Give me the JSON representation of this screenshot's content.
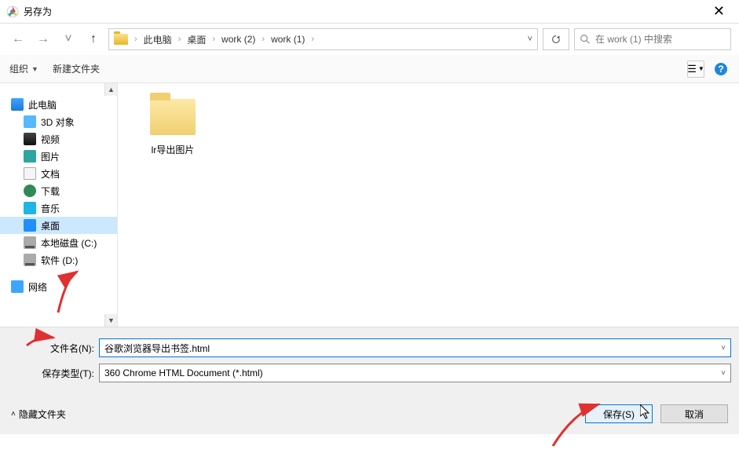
{
  "window": {
    "title": "另存为"
  },
  "breadcrumb": [
    "此电脑",
    "桌面",
    "work (2)",
    "work (1)"
  ],
  "search": {
    "placeholder": "在 work (1) 中搜索"
  },
  "toolbar": {
    "organize": "组织",
    "new_folder": "新建文件夹"
  },
  "tree": [
    {
      "label": "此电脑",
      "icon": "pc",
      "indent": false,
      "selected": false
    },
    {
      "label": "3D 对象",
      "icon": "3d",
      "indent": true,
      "selected": false
    },
    {
      "label": "视频",
      "icon": "vid",
      "indent": true,
      "selected": false
    },
    {
      "label": "图片",
      "icon": "pic",
      "indent": true,
      "selected": false
    },
    {
      "label": "文档",
      "icon": "doc",
      "indent": true,
      "selected": false
    },
    {
      "label": "下载",
      "icon": "dl",
      "indent": true,
      "selected": false
    },
    {
      "label": "音乐",
      "icon": "mus",
      "indent": true,
      "selected": false
    },
    {
      "label": "桌面",
      "icon": "desk",
      "indent": true,
      "selected": true
    },
    {
      "label": "本地磁盘 (C:)",
      "icon": "hd",
      "indent": true,
      "selected": false
    },
    {
      "label": "软件 (D:)",
      "icon": "hd",
      "indent": true,
      "selected": false
    },
    {
      "label": "网络",
      "icon": "net",
      "indent": false,
      "selected": false
    }
  ],
  "content": {
    "folder1": "lr导出图片"
  },
  "form": {
    "filename_label": "文件名(N):",
    "filename_value": "谷歌浏览器导出书签.html",
    "filetype_label": "保存类型(T):",
    "filetype_value": "360 Chrome HTML Document (*.html)"
  },
  "buttons": {
    "hide_folders": "隐藏文件夹",
    "save": "保存(S)",
    "cancel": "取消"
  }
}
